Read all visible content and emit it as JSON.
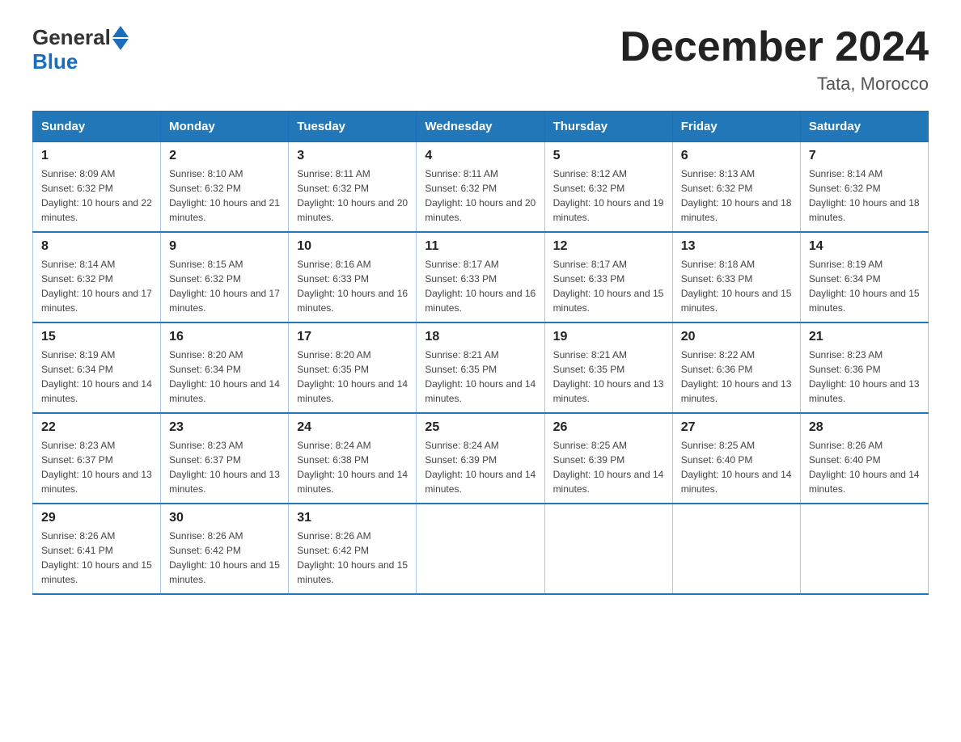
{
  "logo": {
    "text_general": "General",
    "text_blue": "Blue"
  },
  "title": "December 2024",
  "subtitle": "Tata, Morocco",
  "days_of_week": [
    "Sunday",
    "Monday",
    "Tuesday",
    "Wednesday",
    "Thursday",
    "Friday",
    "Saturday"
  ],
  "weeks": [
    [
      {
        "day": "1",
        "sunrise": "8:09 AM",
        "sunset": "6:32 PM",
        "daylight": "10 hours and 22 minutes."
      },
      {
        "day": "2",
        "sunrise": "8:10 AM",
        "sunset": "6:32 PM",
        "daylight": "10 hours and 21 minutes."
      },
      {
        "day": "3",
        "sunrise": "8:11 AM",
        "sunset": "6:32 PM",
        "daylight": "10 hours and 20 minutes."
      },
      {
        "day": "4",
        "sunrise": "8:11 AM",
        "sunset": "6:32 PM",
        "daylight": "10 hours and 20 minutes."
      },
      {
        "day": "5",
        "sunrise": "8:12 AM",
        "sunset": "6:32 PM",
        "daylight": "10 hours and 19 minutes."
      },
      {
        "day": "6",
        "sunrise": "8:13 AM",
        "sunset": "6:32 PM",
        "daylight": "10 hours and 18 minutes."
      },
      {
        "day": "7",
        "sunrise": "8:14 AM",
        "sunset": "6:32 PM",
        "daylight": "10 hours and 18 minutes."
      }
    ],
    [
      {
        "day": "8",
        "sunrise": "8:14 AM",
        "sunset": "6:32 PM",
        "daylight": "10 hours and 17 minutes."
      },
      {
        "day": "9",
        "sunrise": "8:15 AM",
        "sunset": "6:32 PM",
        "daylight": "10 hours and 17 minutes."
      },
      {
        "day": "10",
        "sunrise": "8:16 AM",
        "sunset": "6:33 PM",
        "daylight": "10 hours and 16 minutes."
      },
      {
        "day": "11",
        "sunrise": "8:17 AM",
        "sunset": "6:33 PM",
        "daylight": "10 hours and 16 minutes."
      },
      {
        "day": "12",
        "sunrise": "8:17 AM",
        "sunset": "6:33 PM",
        "daylight": "10 hours and 15 minutes."
      },
      {
        "day": "13",
        "sunrise": "8:18 AM",
        "sunset": "6:33 PM",
        "daylight": "10 hours and 15 minutes."
      },
      {
        "day": "14",
        "sunrise": "8:19 AM",
        "sunset": "6:34 PM",
        "daylight": "10 hours and 15 minutes."
      }
    ],
    [
      {
        "day": "15",
        "sunrise": "8:19 AM",
        "sunset": "6:34 PM",
        "daylight": "10 hours and 14 minutes."
      },
      {
        "day": "16",
        "sunrise": "8:20 AM",
        "sunset": "6:34 PM",
        "daylight": "10 hours and 14 minutes."
      },
      {
        "day": "17",
        "sunrise": "8:20 AM",
        "sunset": "6:35 PM",
        "daylight": "10 hours and 14 minutes."
      },
      {
        "day": "18",
        "sunrise": "8:21 AM",
        "sunset": "6:35 PM",
        "daylight": "10 hours and 14 minutes."
      },
      {
        "day": "19",
        "sunrise": "8:21 AM",
        "sunset": "6:35 PM",
        "daylight": "10 hours and 13 minutes."
      },
      {
        "day": "20",
        "sunrise": "8:22 AM",
        "sunset": "6:36 PM",
        "daylight": "10 hours and 13 minutes."
      },
      {
        "day": "21",
        "sunrise": "8:23 AM",
        "sunset": "6:36 PM",
        "daylight": "10 hours and 13 minutes."
      }
    ],
    [
      {
        "day": "22",
        "sunrise": "8:23 AM",
        "sunset": "6:37 PM",
        "daylight": "10 hours and 13 minutes."
      },
      {
        "day": "23",
        "sunrise": "8:23 AM",
        "sunset": "6:37 PM",
        "daylight": "10 hours and 13 minutes."
      },
      {
        "day": "24",
        "sunrise": "8:24 AM",
        "sunset": "6:38 PM",
        "daylight": "10 hours and 14 minutes."
      },
      {
        "day": "25",
        "sunrise": "8:24 AM",
        "sunset": "6:39 PM",
        "daylight": "10 hours and 14 minutes."
      },
      {
        "day": "26",
        "sunrise": "8:25 AM",
        "sunset": "6:39 PM",
        "daylight": "10 hours and 14 minutes."
      },
      {
        "day": "27",
        "sunrise": "8:25 AM",
        "sunset": "6:40 PM",
        "daylight": "10 hours and 14 minutes."
      },
      {
        "day": "28",
        "sunrise": "8:26 AM",
        "sunset": "6:40 PM",
        "daylight": "10 hours and 14 minutes."
      }
    ],
    [
      {
        "day": "29",
        "sunrise": "8:26 AM",
        "sunset": "6:41 PM",
        "daylight": "10 hours and 15 minutes."
      },
      {
        "day": "30",
        "sunrise": "8:26 AM",
        "sunset": "6:42 PM",
        "daylight": "10 hours and 15 minutes."
      },
      {
        "day": "31",
        "sunrise": "8:26 AM",
        "sunset": "6:42 PM",
        "daylight": "10 hours and 15 minutes."
      },
      null,
      null,
      null,
      null
    ]
  ]
}
